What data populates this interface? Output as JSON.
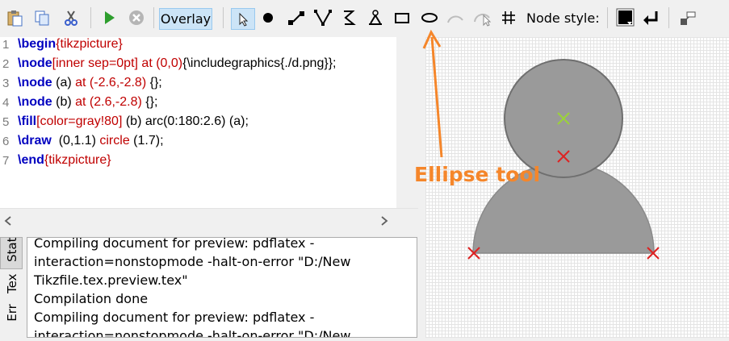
{
  "toolbar": {
    "overlay_label": "Overlay",
    "node_style_label": "Node style:",
    "icons": [
      "paste-icon",
      "copy-icon",
      "cut-icon",
      "play-icon",
      "stop-icon",
      "pointer-icon",
      "node-dot-icon",
      "edge-icon",
      "path-icon",
      "curve-icon",
      "fork-icon",
      "rectangle-icon",
      "ellipse-icon",
      "arc-icon",
      "arc-select-icon",
      "grid-icon",
      "node-style-swatch",
      "return-icon",
      "node-tool-icon"
    ]
  },
  "editor": {
    "line_numbers": [
      "1",
      "2",
      "3",
      "4",
      "5",
      "6",
      "7"
    ],
    "lines": [
      {
        "kw": "\\begin",
        "rest": "{tikzpicture}"
      },
      {
        "kw": "\\node",
        "opt": "[inner sep=0pt]",
        "at": " at ",
        "coord": "(0,0)",
        "rest": "{\\includegraphics{./d.png}};"
      },
      {
        "kw": "\\node",
        "rest1": " (a) ",
        "at": "at",
        "coord": " (-2.6,-2.8)",
        "rest": " {};"
      },
      {
        "kw": "\\node",
        "rest1": " (b) ",
        "at": "at",
        "coord": " (2.6,-2.8)",
        "rest": " {};"
      },
      {
        "kw": "\\fill",
        "opt": "[color=gray!80]",
        "rest": " (b) arc(0:180:2.6) (a);"
      },
      {
        "kw": "\\draw",
        "rest1": "  (0,1.1) ",
        "at": "circle",
        "coord": " (1.7);"
      },
      {
        "kw": "\\end",
        "rest": "{tikzpicture}"
      }
    ]
  },
  "side_tabs": [
    "Stat",
    "Tex",
    "Err"
  ],
  "log": {
    "lines": [
      "Compiling document for preview: pdflatex -",
      "interaction=nonstopmode -halt-on-error \"D:/New",
      "Tikzfile.tex.preview.tex\"",
      "Compilation done",
      "Compiling document for preview: pdflatex -",
      "interaction=nonstopmode -halt-on-error \"D:/New"
    ]
  },
  "annotation": {
    "label": "Ellipse tool",
    "color": "#f5862a"
  },
  "colors": {
    "figure_gray": "#999999",
    "marker_red": "#dd2222",
    "marker_green": "#9bd23a",
    "keyword_blue": "#0000c0",
    "arg_red": "#c00000"
  }
}
